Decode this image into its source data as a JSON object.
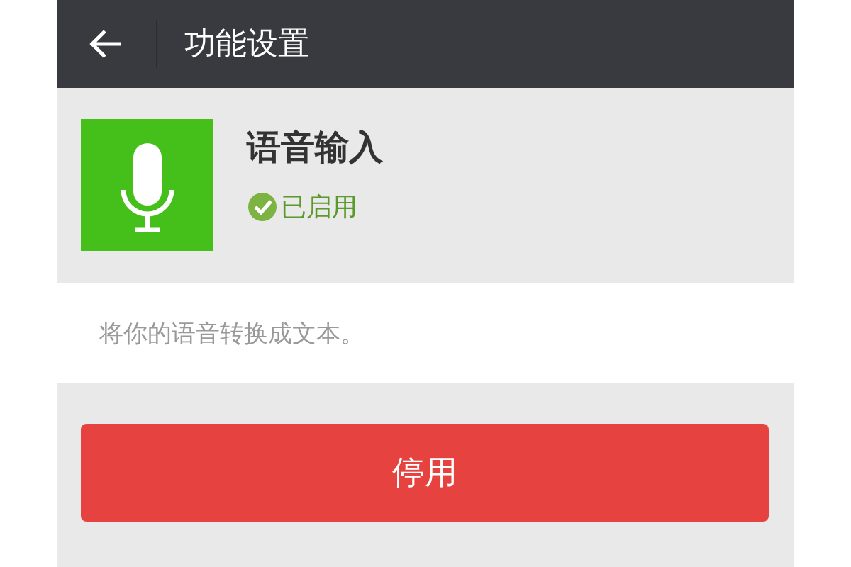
{
  "header": {
    "title": "功能设置"
  },
  "feature": {
    "name": "语音输入",
    "status": "已启用",
    "enabled": true
  },
  "description": "将你的语音转换成文本。",
  "action_button": {
    "label": "停用"
  }
}
